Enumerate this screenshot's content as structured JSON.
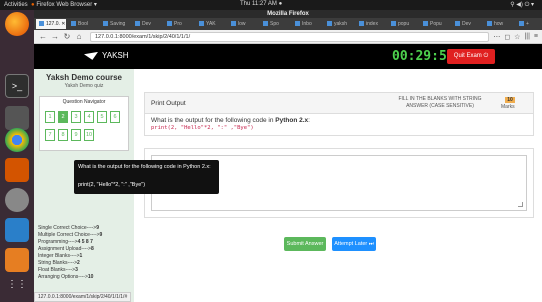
{
  "os": {
    "activities": "Activities",
    "app_menu": "Firefox Web Browser ▾",
    "clock": "Thu 11:27 AM ●",
    "tray": "⚲ ◀) ⏻ ▾"
  },
  "launcher": {
    "icons": [
      "firefox-icon",
      "terminal-icon",
      "editor-icon",
      "chrome-icon",
      "files-icon",
      "settings-icon",
      "writer-icon",
      "software-icon",
      "trash-icon",
      "apps-grid-icon"
    ]
  },
  "browser": {
    "window_title": "Mozilla Firefox",
    "tabs": [
      "127.0. ✕",
      "Bool",
      "Saving",
      "Dev",
      "Pro",
      "YAK",
      "low",
      "Spo",
      "Inbo",
      "yaksh",
      "index",
      "popu",
      "Popu",
      "Dev",
      "how",
      "+"
    ],
    "url": "127.0.0.1:8000/exam/1/skip/2/40/1/1/1/",
    "status_url": "127.0.0.1:8000/exam/1/skip/2/40/1/1/1/#"
  },
  "header": {
    "logo_text": "YAKSH",
    "timer": "00:29:51",
    "quit_label": "Quit Exam ⏻"
  },
  "sidebar": {
    "course_title": "Yaksh Demo course",
    "course_subtitle": "Yaksh Demo quiz",
    "navigator_title": "Question Navigator",
    "questions": [
      "1",
      "2",
      "3",
      "4",
      "5",
      "6",
      "7",
      "8",
      "9",
      "10"
    ],
    "current_question": "2",
    "counts": [
      {
        "label": "Single Correct Choice---->",
        "value": "9"
      },
      {
        "label": "Multiple Correct Choice---->",
        "value": "9"
      },
      {
        "label": "Programming---->",
        "value": "4 5 8 7"
      },
      {
        "label": "Assignment Upload---->",
        "value": "8"
      },
      {
        "label": "Integer Blanks---->",
        "value": "1"
      },
      {
        "label": "String Blanks---->",
        "value": "2"
      },
      {
        "label": "Float Blanks---->",
        "value": "3"
      },
      {
        "label": "Arranging Options---->",
        "value": "10"
      }
    ]
  },
  "tooltip": {
    "line1": "What is the output for the following code in Python 2.x:",
    "line2": "print(2, \"Hello\"*2, \":\" ,\"Bye\")"
  },
  "question": {
    "header_title": "Print Output",
    "type_label": "FILL IN THE BLANKS WITH STRING ANSWER (CASE SENSITIVE)",
    "marks_value": "10",
    "marks_label": "Marks",
    "text_prefix": "What is the output for the following code in ",
    "text_bold": "Python 2.x",
    "text_suffix": ":",
    "code": "print(2, \"Hello\"*2, \":\" ,\"Bye\")"
  },
  "answer": {
    "value": ""
  },
  "actions": {
    "submit_label": "Submit Answer",
    "attempt_later_label": "Attempt Later ⏭"
  }
}
